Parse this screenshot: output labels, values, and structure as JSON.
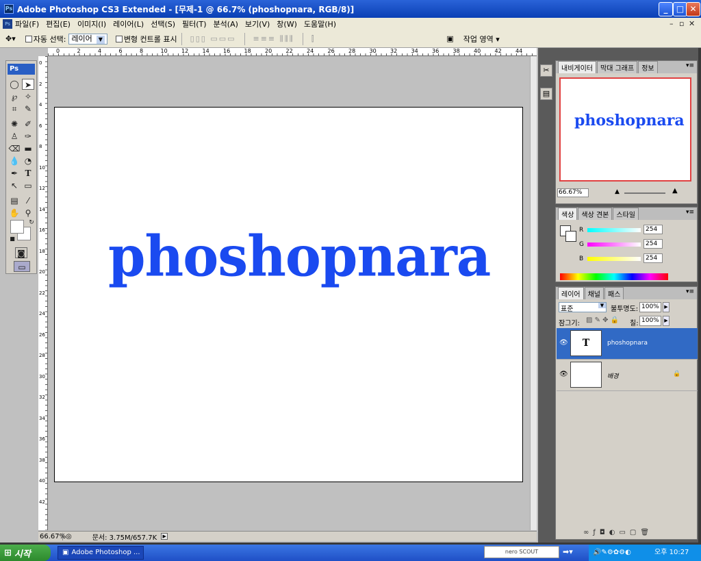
{
  "window": {
    "title": "Adobe Photoshop CS3 Extended - [무제-1 @ 66.7% (phoshopnara, RGB/8)]",
    "app_icon": "Ps"
  },
  "menu": [
    "파일(F)",
    "편집(E)",
    "이미지(I)",
    "레이어(L)",
    "선택(S)",
    "필터(T)",
    "분석(A)",
    "보기(V)",
    "창(W)",
    "도움말(H)"
  ],
  "options": {
    "auto_select_label": "자동 선택:",
    "auto_select_value": "레이어",
    "transform_label": "변형 컨트롤 표시",
    "workspace_label": "작업 영역 ▾"
  },
  "ruler_numbers": [
    "0",
    "2",
    "4",
    "6",
    "8",
    "10",
    "12",
    "14",
    "16",
    "18",
    "20",
    "22",
    "24",
    "26",
    "28",
    "30",
    "32",
    "34",
    "36",
    "38",
    "40",
    "42",
    "44"
  ],
  "canvas": {
    "text": "phoshopnara",
    "text_color": "#1a4af0"
  },
  "status": {
    "zoom": "66.67%",
    "doc": "문서: 3.75M/657.7K"
  },
  "navigator": {
    "tabs": [
      "내비게이터",
      "막대 그래프",
      "정보"
    ],
    "thumb_text": "phoshopnara",
    "zoom": "66.67%"
  },
  "color": {
    "tabs": [
      "색상",
      "색상 견본",
      "스타일"
    ],
    "channels": [
      {
        "name": "R",
        "value": "254"
      },
      {
        "name": "G",
        "value": "254"
      },
      {
        "name": "B",
        "value": "254"
      }
    ]
  },
  "layers": {
    "tabs": [
      "레이어",
      "채널",
      "패스"
    ],
    "blend_mode": "표준",
    "opacity_label": "불투명도:",
    "opacity": "100%",
    "lock_label": "잠그기:",
    "fill_label": "칠:",
    "fill": "100%",
    "items": [
      {
        "name": "phoshopnara",
        "thumb": "T",
        "selected": true
      },
      {
        "name": "배경",
        "thumb": "",
        "selected": false
      }
    ]
  },
  "taskbar": {
    "start": "시작",
    "task": "Adobe Photoshop ...",
    "nero": "nero SCOUT",
    "clock_prefix": "오후",
    "clock": "10:27"
  }
}
